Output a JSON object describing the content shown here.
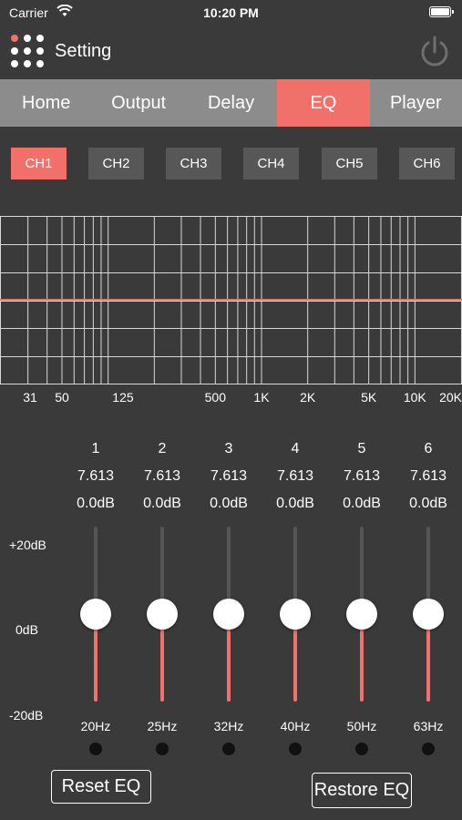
{
  "status_bar": {
    "carrier": "Carrier",
    "time": "10:20 PM"
  },
  "header": {
    "title": "Setting",
    "menu_icon": "grid-menu-icon",
    "power_icon": "power-icon"
  },
  "tabs": [
    {
      "label": "Home",
      "active": false
    },
    {
      "label": "Output",
      "active": false
    },
    {
      "label": "Delay",
      "active": false
    },
    {
      "label": "EQ",
      "active": true
    },
    {
      "label": "Player",
      "active": false
    }
  ],
  "channels": [
    {
      "label": "CH1",
      "active": true
    },
    {
      "label": "CH2",
      "active": false
    },
    {
      "label": "CH3",
      "active": false
    },
    {
      "label": "CH4",
      "active": false
    },
    {
      "label": "CH5",
      "active": false
    },
    {
      "label": "CH6",
      "active": false
    }
  ],
  "graph": {
    "freq_labels": [
      "31",
      "50",
      "125",
      "500",
      "1K",
      "2K",
      "5K",
      "10K",
      "20K"
    ],
    "freq_values": [
      31,
      50,
      125,
      500,
      1000,
      2000,
      5000,
      10000,
      20000
    ],
    "curve_gain_db": 0
  },
  "db_scale": {
    "top": "+20dB",
    "mid": "0dB",
    "bottom": "-20dB"
  },
  "bands": [
    {
      "num": "1",
      "q": "7.613",
      "gain": "0.0dB",
      "gain_value": 0,
      "freq": "20Hz"
    },
    {
      "num": "2",
      "q": "7.613",
      "gain": "0.0dB",
      "gain_value": 0,
      "freq": "25Hz"
    },
    {
      "num": "3",
      "q": "7.613",
      "gain": "0.0dB",
      "gain_value": 0,
      "freq": "32Hz"
    },
    {
      "num": "4",
      "q": "7.613",
      "gain": "0.0dB",
      "gain_value": 0,
      "freq": "40Hz"
    },
    {
      "num": "5",
      "q": "7.613",
      "gain": "0.0dB",
      "gain_value": 0,
      "freq": "50Hz"
    },
    {
      "num": "6",
      "q": "7.613",
      "gain": "0.0dB",
      "gain_value": 0,
      "freq": "63Hz"
    }
  ],
  "buttons": {
    "reset": "Reset EQ",
    "restore": "Restore EQ"
  },
  "colors": {
    "accent": "#f2706a",
    "background": "#3a3a3a",
    "tab_bar": "#8c8c8c",
    "channel_button": "#575757"
  }
}
